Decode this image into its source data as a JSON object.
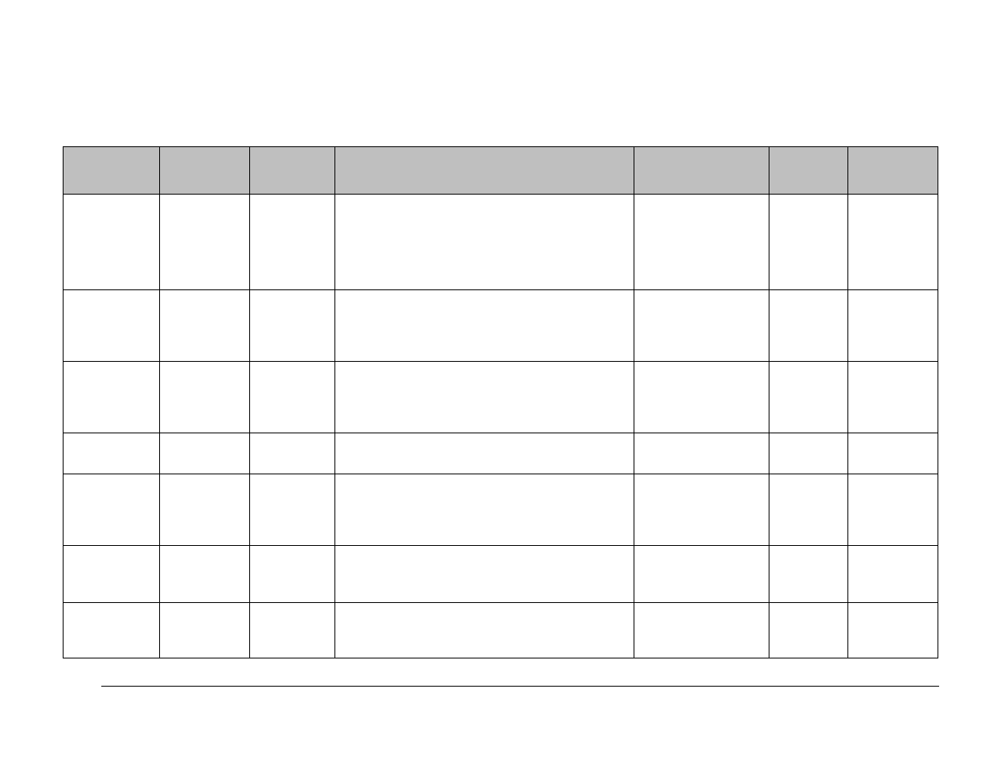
{
  "table": {
    "headers": [
      "",
      "",
      "",
      "",
      "",
      "",
      ""
    ],
    "rows": [
      [
        "",
        "",
        "",
        "",
        "",
        "",
        ""
      ],
      [
        "",
        "",
        "",
        "",
        "",
        "",
        ""
      ],
      [
        "",
        "",
        "",
        "",
        "",
        "",
        ""
      ],
      [
        "",
        "",
        "",
        "",
        "",
        "",
        ""
      ],
      [
        "",
        "",
        "",
        "",
        "",
        "",
        ""
      ],
      [
        "",
        "",
        "",
        "",
        "",
        "",
        ""
      ],
      [
        "",
        "",
        "",
        "",
        "",
        "",
        ""
      ]
    ]
  }
}
